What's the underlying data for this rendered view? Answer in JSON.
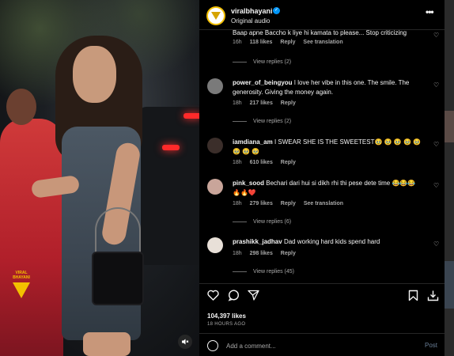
{
  "video": {
    "watermark_text": "VIRAL BHAYANI",
    "mute_icon": "speaker-muted-icon"
  },
  "header": {
    "username": "viralbhayani",
    "verified": true,
    "audio": "Original audio",
    "more_icon": "more-dots-icon"
  },
  "comments": [
    {
      "username": "",
      "text": "Baap apne Baccho k liye hi kamata to please... Stop criticizing",
      "time": "16h",
      "likes": "118 likes",
      "reply": "Reply",
      "see_translation": "See translation",
      "view_replies": "View replies (2)"
    },
    {
      "username": "power_of_beingyou",
      "text": "I love her vibe in this one. The smile. The generosity. Giving the money again.",
      "time": "18h",
      "likes": "217 likes",
      "reply": "Reply",
      "view_replies": "View replies (2)"
    },
    {
      "username": "iamdiana_am",
      "text": "I SWEAR SHE IS THE SWEETEST🥹 🥹 🥹 🥹 🥹 🥹 🥹 🥹",
      "time": "18h",
      "likes": "610 likes",
      "reply": "Reply"
    },
    {
      "username": "pink_sood",
      "text": "Bechari dari hui si dikh rhi thi pese dete time 😂😂😂🔥🔥❤️",
      "time": "18h",
      "likes": "279 likes",
      "reply": "Reply",
      "see_translation": "See translation",
      "view_replies": "View replies (6)"
    },
    {
      "username": "prashikk_jadhav",
      "text": "Dad working hard kids spend hard",
      "time": "18h",
      "likes": "298 likes",
      "reply": "Reply",
      "view_replies": "View replies (45)"
    }
  ],
  "actions": {
    "likes_count": "104,397 likes",
    "posted_ago": "18 HOURS AGO"
  },
  "add_comment": {
    "placeholder": "Add a comment...",
    "post_label": "Post"
  }
}
